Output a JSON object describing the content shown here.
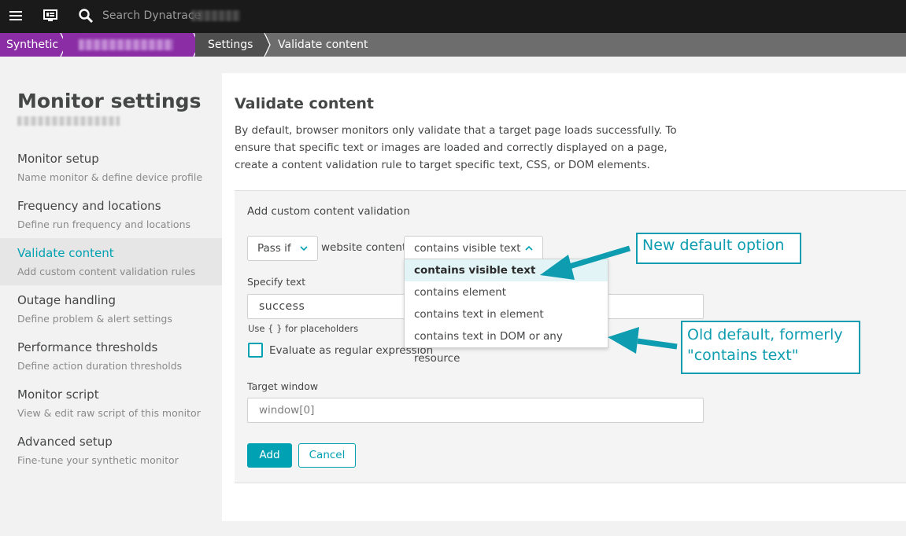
{
  "topbar": {
    "search_placeholder": "Search Dynatrace"
  },
  "breadcrumb": {
    "items": [
      "Synthetic",
      "Settings",
      "Validate content"
    ]
  },
  "sidebar": {
    "title": "Monitor settings",
    "items": [
      {
        "label": "Monitor setup",
        "desc": "Name monitor & define device profile"
      },
      {
        "label": "Frequency and locations",
        "desc": "Define run frequency and locations"
      },
      {
        "label": "Validate content",
        "desc": "Add custom content validation rules"
      },
      {
        "label": "Outage handling",
        "desc": "Define problem & alert settings"
      },
      {
        "label": "Performance thresholds",
        "desc": "Define action duration thresholds"
      },
      {
        "label": "Monitor script",
        "desc": "View & edit raw script of this monitor"
      },
      {
        "label": "Advanced setup",
        "desc": "Fine-tune your synthetic monitor"
      }
    ]
  },
  "main": {
    "title": "Validate content",
    "description": "By default, browser monitors only validate that a target page loads successfully. To ensure that specific text or images are loaded and correctly displayed on a page, create a content validation rule to target specific text, CSS, or DOM elements.",
    "card": {
      "heading": "Add custom content validation",
      "pass_select": "Pass if",
      "website_content_label": "website content",
      "content_select": "contains visible text",
      "dropdown_options": [
        "contains visible text",
        "contains element",
        "contains text in element",
        "contains text in DOM or any resource"
      ],
      "specify_text_label": "Specify text",
      "specify_text_value": "success",
      "placeholder_hint": "Use { } for placeholders",
      "regex_label": "Evaluate as regular expression",
      "target_window_label": "Target window",
      "target_window_value": "window[0]",
      "add_button": "Add",
      "cancel_button": "Cancel"
    }
  },
  "annotations": {
    "new_default": "New default option",
    "old_default_line1": "Old default, formerly",
    "old_default_line2": "\"contains text\""
  },
  "colors": {
    "accent": "#00a1b2",
    "breadcrumb_purple": "#8b2ea5",
    "topbar": "#1a1a1a",
    "callout": "#0e9db0"
  }
}
